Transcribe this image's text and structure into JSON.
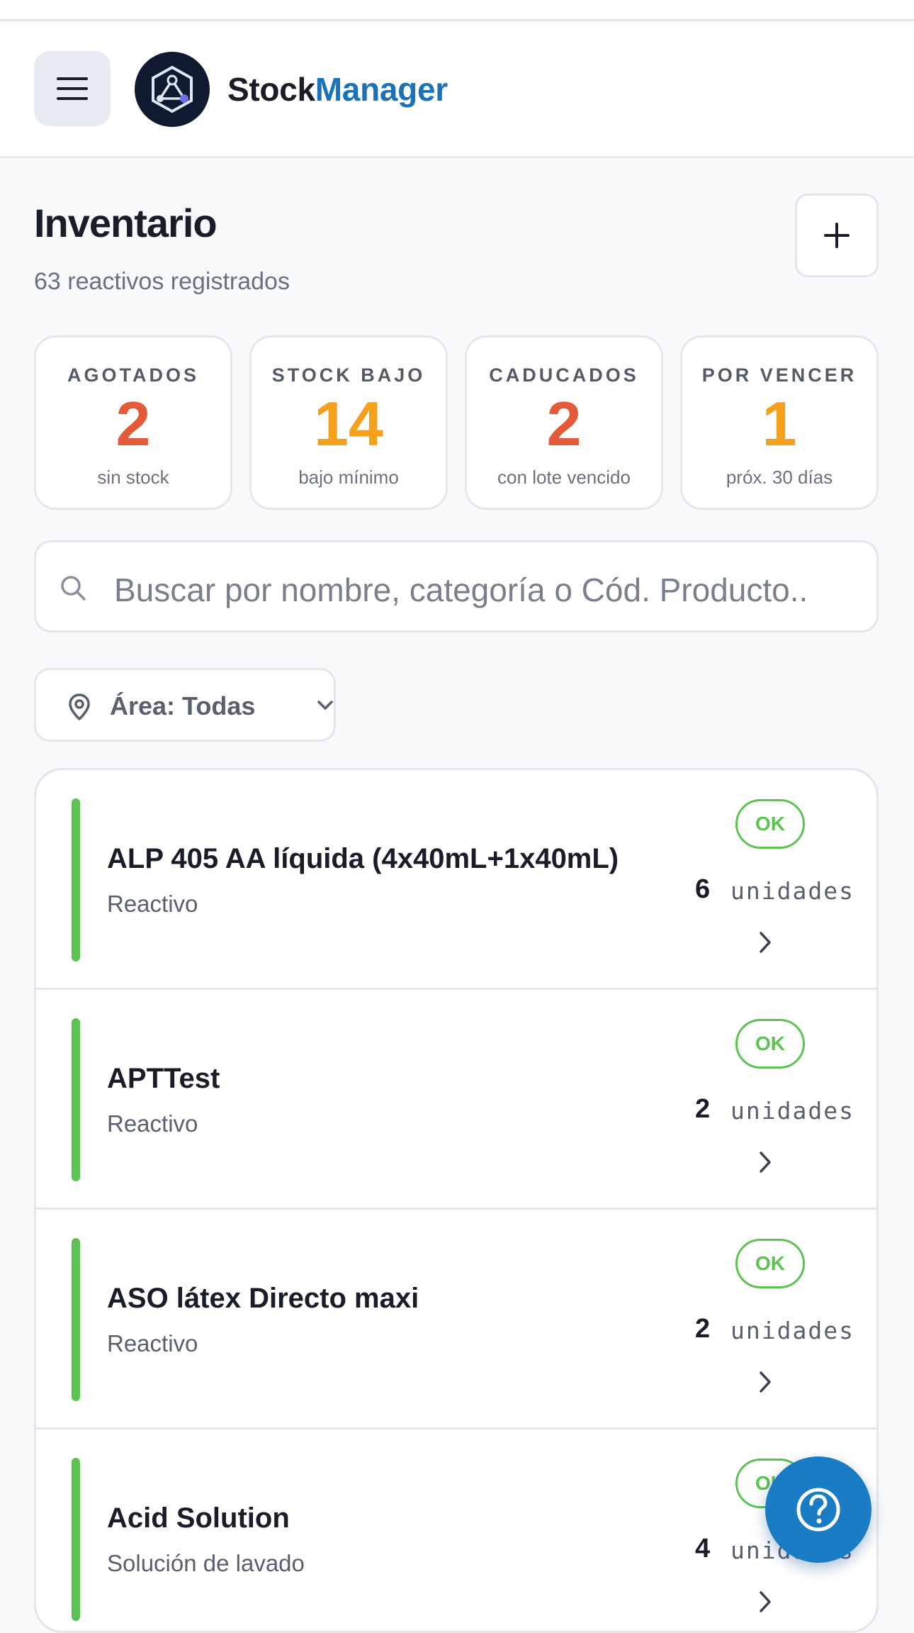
{
  "header": {
    "brand_part1": "Stock",
    "brand_part2": "Manager"
  },
  "page": {
    "title": "Inventario",
    "subtitle": "63 reactivos registrados"
  },
  "stats": [
    {
      "label": "AGOTADOS",
      "value": "2",
      "caption": "sin stock",
      "color": "#e35a3a"
    },
    {
      "label": "STOCK BAJO",
      "value": "14",
      "caption": "bajo mínimo",
      "color": "#f5a01a"
    },
    {
      "label": "CADUCADOS",
      "value": "2",
      "caption": "con lote vencido",
      "color": "#e35a3a"
    },
    {
      "label": "POR VENCER",
      "value": "1",
      "caption": "próx. 30 días",
      "color": "#f5a01a"
    }
  ],
  "search": {
    "placeholder": "Buscar por nombre, categoría o Cód. Producto.."
  },
  "filter": {
    "area_label": "Área: Todas"
  },
  "items": [
    {
      "name": "ALP 405 AA líquida (4x40mL+1x40mL)",
      "category": "Reactivo",
      "status": "OK",
      "qty": "6",
      "unit": "unidades"
    },
    {
      "name": "APTTest",
      "category": "Reactivo",
      "status": "OK",
      "qty": "2",
      "unit": "unidades"
    },
    {
      "name": "ASO látex Directo maxi",
      "category": "Reactivo",
      "status": "OK",
      "qty": "2",
      "unit": "unidades"
    },
    {
      "name": "Acid Solution",
      "category": "Solución de lavado",
      "status": "OK",
      "qty": "4",
      "unit": "unidades"
    }
  ],
  "colors": {
    "accent": "#1a73b8",
    "ok": "#5cc251",
    "danger": "#e35a3a",
    "warning": "#f5a01a"
  },
  "icons": {
    "menu": "hamburger-menu-icon",
    "logo": "stockmanager-logo",
    "add": "plus-icon",
    "search": "search-icon",
    "location": "map-pin-icon",
    "dropdown": "chevron-down-icon",
    "row_arrow": "chevron-right-icon",
    "help": "help-circle-icon"
  }
}
